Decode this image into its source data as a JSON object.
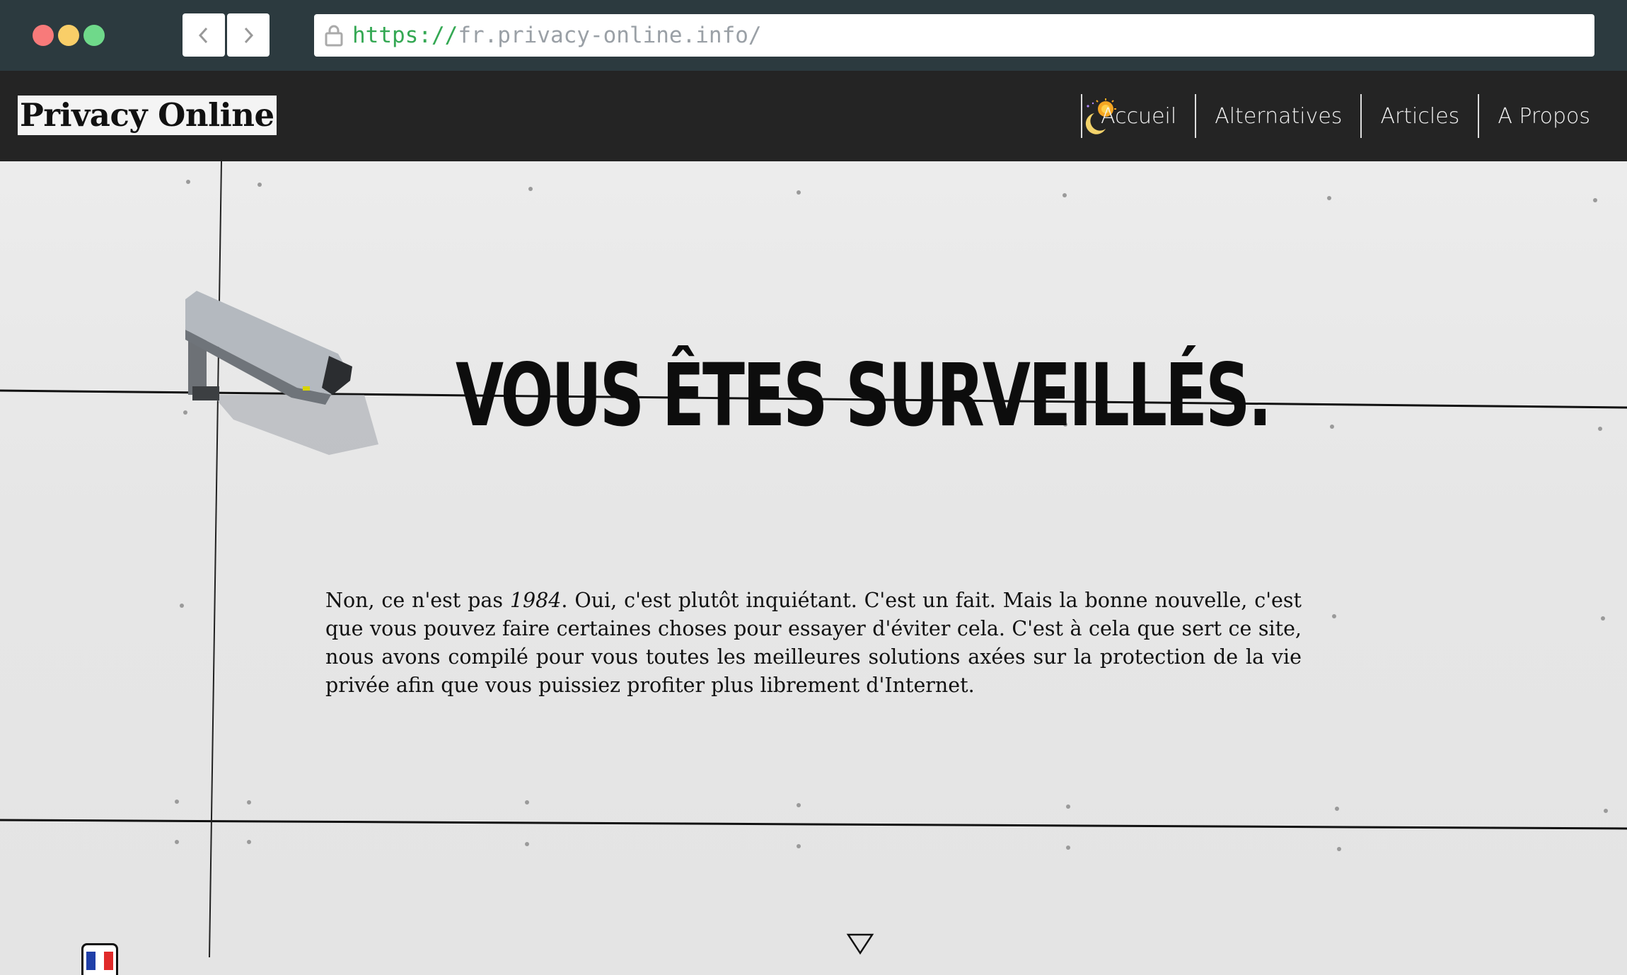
{
  "browser": {
    "url_scheme": "https://",
    "url_rest": "fr.privacy-online.info/"
  },
  "header": {
    "logo": "Privacy Online",
    "nav": [
      {
        "label": "Accueil"
      },
      {
        "label": "Alternatives"
      },
      {
        "label": "Articles"
      },
      {
        "label": "A Propos"
      }
    ]
  },
  "hero": {
    "title": "VOUS ÊTES SURVEILLÉS.",
    "text_before": "Non, ce n'est pas ",
    "text_emphasis": "1984",
    "text_after": ". Oui, c'est plutôt inquiétant. C'est un fait. Mais la bonne nouvelle, c'est que vous pouvez faire certaines choses pour essayer d'éviter cela. C'est à cela que sert ce site, nous avons compilé pour vous toutes les meilleures solutions axées sur la protection de la vie privée afin que vous puissiez profiter plus librement d'Internet."
  },
  "icons": {
    "lock": "lock-icon",
    "back": "chevron-left-icon",
    "forward": "chevron-right-icon",
    "theme": "moon-sun-icon",
    "scroll": "triangle-down-icon",
    "language": "french-flag-icon"
  },
  "colors": {
    "header_bg": "#242424",
    "chrome_bg": "#2c3a3f",
    "url_scheme": "#34a853"
  }
}
